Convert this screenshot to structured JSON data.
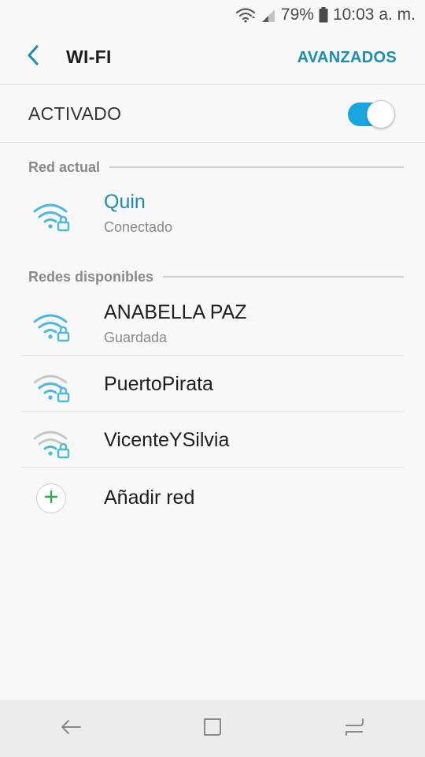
{
  "status_bar": {
    "battery_percent": "79%",
    "time": "10:03 a. m."
  },
  "appbar": {
    "title": "WI-FI",
    "action_label": "AVANZADOS"
  },
  "master_switch": {
    "label": "ACTIVADO",
    "on": true
  },
  "current_network": {
    "section_title": "Red actual",
    "name": "Quin",
    "status": "Conectado"
  },
  "available_networks": {
    "section_title": "Redes disponibles",
    "items": [
      {
        "name": "ANABELLA PAZ",
        "status": "Guardada"
      },
      {
        "name": "PuertoPirata"
      },
      {
        "name": "VicenteYSilvia"
      }
    ],
    "add_label": "Añadir red"
  },
  "colors": {
    "accent": "#1a8cb5",
    "toggle_on": "#17a6e0",
    "wifi_strong": "#4bb8de",
    "wifi_weak": "#c8c8c8",
    "add_plus": "#2fa84f"
  },
  "icons": {
    "back": "chevron-left-icon",
    "wifi_locked": "wifi-lock-icon",
    "add": "plus-icon",
    "nav_back": "nav-back-icon",
    "nav_home": "nav-home-icon",
    "nav_recents": "nav-recents-icon"
  }
}
